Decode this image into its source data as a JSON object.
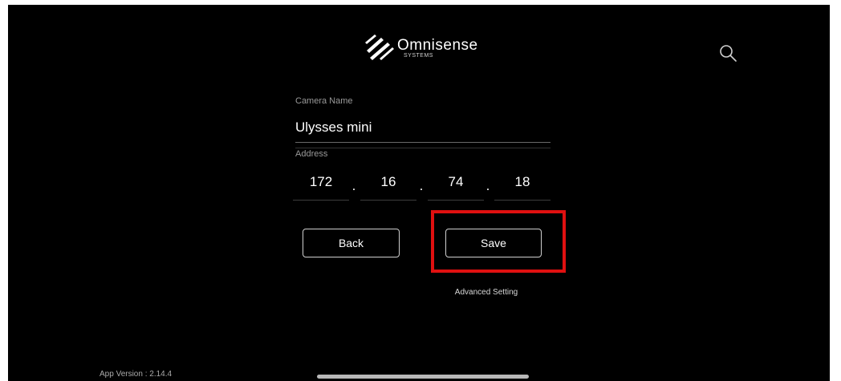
{
  "header": {
    "brand_name": "Omnisense",
    "brand_subtitle": "SYSTEMS",
    "search_icon": "search-icon"
  },
  "form": {
    "camera_name_label": "Camera Name",
    "camera_name_value": "Ulysses mini",
    "address_label": "Address",
    "address_octets": [
      "172",
      "16",
      "74",
      "18"
    ],
    "address_separator": "."
  },
  "actions": {
    "back_label": "Back",
    "save_label": "Save",
    "advanced_label": "Advanced Setting"
  },
  "footer": {
    "app_version": "App Version : 2.14.4"
  },
  "colors": {
    "background": "#000000",
    "text": "#ffffff",
    "highlight": "#e01010"
  }
}
